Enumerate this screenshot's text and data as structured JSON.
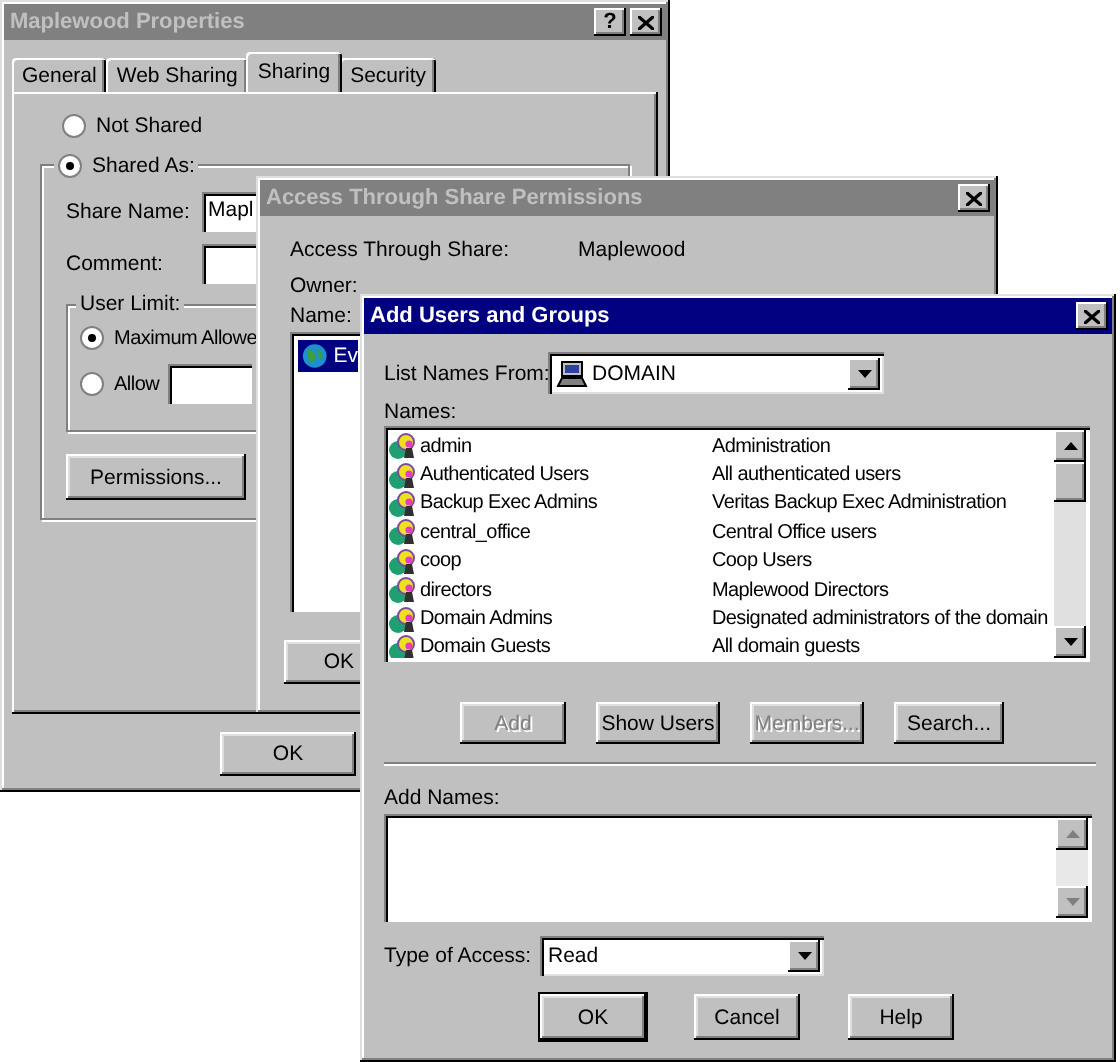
{
  "properties_window": {
    "title": "Maplewood Properties",
    "active": false,
    "help_button": "?",
    "tabs": [
      {
        "label": "General",
        "selected": false
      },
      {
        "label": "Web Sharing",
        "selected": false
      },
      {
        "label": "Sharing",
        "selected": true
      },
      {
        "label": "Security",
        "selected": false
      }
    ],
    "not_shared": {
      "label": "Not Shared",
      "selected": false
    },
    "shared_as": {
      "label": "Shared As:",
      "selected": true
    },
    "share_name": {
      "label": "Share Name:",
      "value": "Mapl"
    },
    "comment": {
      "label": "Comment:"
    },
    "user_limit": {
      "title": "User Limit:",
      "options": [
        {
          "label": "Maximum Allowe",
          "selected": true,
          "kind": "plain"
        },
        {
          "label": "Allow",
          "selected": false,
          "kind": "field"
        }
      ]
    },
    "permissions_button": "Permissions...",
    "ok_button": "OK"
  },
  "permissions_window": {
    "title": "Access Through Share Permissions",
    "active": false,
    "share_label": "Access Through Share:",
    "share_value": "Maplewood",
    "owner_label": "Owner:",
    "name_label": "Name:",
    "entries": [
      {
        "name": "Ev",
        "selected": true
      }
    ],
    "ok_button": "OK"
  },
  "add_users_window": {
    "title": "Add Users and Groups",
    "active": true,
    "list_names_from": {
      "label": "List Names From:",
      "value": "DOMAIN"
    },
    "names_label": "Names:",
    "names": [
      {
        "name": "admin",
        "description": "Administration"
      },
      {
        "name": "Authenticated Users",
        "description": "All authenticated users"
      },
      {
        "name": "Backup Exec Admins",
        "description": "Veritas Backup Exec Administration"
      },
      {
        "name": "central_office",
        "description": "Central Office users"
      },
      {
        "name": "coop",
        "description": "Coop Users"
      },
      {
        "name": "directors",
        "description": "Maplewood Directors"
      },
      {
        "name": "Domain Admins",
        "description": "Designated administrators of the domain"
      },
      {
        "name": "Domain Guests",
        "description": "All domain guests"
      }
    ],
    "buttons": [
      {
        "label": "Add",
        "disabled": true
      },
      {
        "label": "Show Users",
        "disabled": false
      },
      {
        "label": "Members...",
        "disabled": true
      },
      {
        "label": "Search...",
        "disabled": false
      }
    ],
    "add_names_label": "Add Names:",
    "type_of_access": {
      "label": "Type of Access:",
      "value": "Read"
    },
    "dialog_buttons": [
      "OK",
      "Cancel",
      "Help"
    ]
  }
}
